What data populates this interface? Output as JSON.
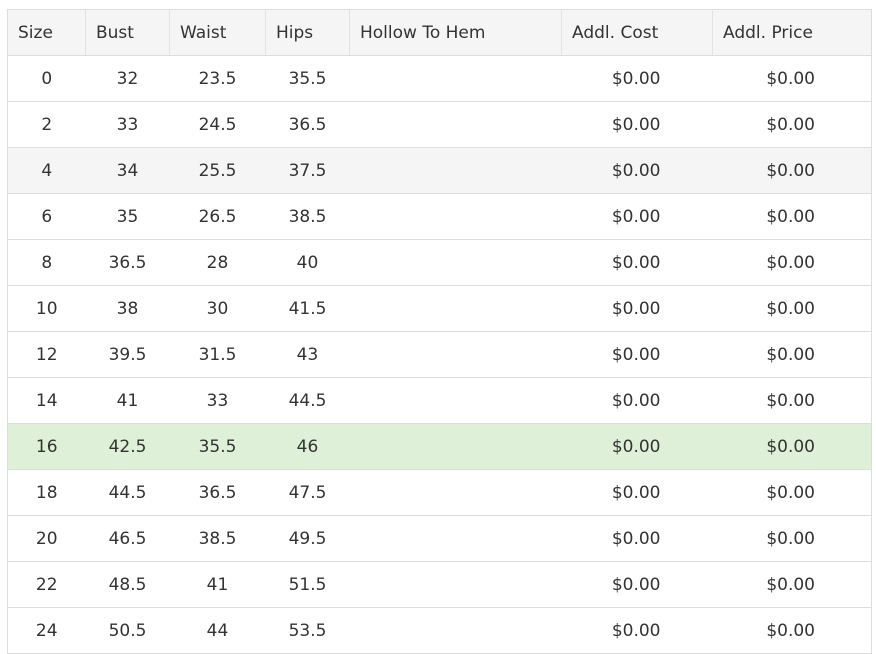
{
  "table": {
    "columns": [
      "Size",
      "Bust",
      "Waist",
      "Hips",
      "Hollow To Hem",
      "Addl. Cost",
      "Addl. Price"
    ],
    "rows": [
      {
        "size": "0",
        "bust": "32",
        "waist": "23.5",
        "hips": "35.5",
        "hollow": "",
        "cost": "$0.00",
        "price": "$0.00"
      },
      {
        "size": "2",
        "bust": "33",
        "waist": "24.5",
        "hips": "36.5",
        "hollow": "",
        "cost": "$0.00",
        "price": "$0.00"
      },
      {
        "size": "4",
        "bust": "34",
        "waist": "25.5",
        "hips": "37.5",
        "hollow": "",
        "cost": "$0.00",
        "price": "$0.00"
      },
      {
        "size": "6",
        "bust": "35",
        "waist": "26.5",
        "hips": "38.5",
        "hollow": "",
        "cost": "$0.00",
        "price": "$0.00"
      },
      {
        "size": "8",
        "bust": "36.5",
        "waist": "28",
        "hips": "40",
        "hollow": "",
        "cost": "$0.00",
        "price": "$0.00"
      },
      {
        "size": "10",
        "bust": "38",
        "waist": "30",
        "hips": "41.5",
        "hollow": "",
        "cost": "$0.00",
        "price": "$0.00"
      },
      {
        "size": "12",
        "bust": "39.5",
        "waist": "31.5",
        "hips": "43",
        "hollow": "",
        "cost": "$0.00",
        "price": "$0.00"
      },
      {
        "size": "14",
        "bust": "41",
        "waist": "33",
        "hips": "44.5",
        "hollow": "",
        "cost": "$0.00",
        "price": "$0.00"
      },
      {
        "size": "16",
        "bust": "42.5",
        "waist": "35.5",
        "hips": "46",
        "hollow": "",
        "cost": "$0.00",
        "price": "$0.00"
      },
      {
        "size": "18",
        "bust": "44.5",
        "waist": "36.5",
        "hips": "47.5",
        "hollow": "",
        "cost": "$0.00",
        "price": "$0.00"
      },
      {
        "size": "20",
        "bust": "46.5",
        "waist": "38.5",
        "hips": "49.5",
        "hollow": "",
        "cost": "$0.00",
        "price": "$0.00"
      },
      {
        "size": "22",
        "bust": "48.5",
        "waist": "41",
        "hips": "51.5",
        "hollow": "",
        "cost": "$0.00",
        "price": "$0.00"
      },
      {
        "size": "24",
        "bust": "50.5",
        "waist": "44",
        "hips": "53.5",
        "hollow": "",
        "cost": "$0.00",
        "price": "$0.00"
      }
    ],
    "hover_row_index": 2,
    "selected_row_index": 8,
    "colors": {
      "header_bg": "#f5f5f5",
      "hover_bg": "#f5f5f5",
      "selected_bg": "#dff0d8",
      "border": "#dddddd",
      "text": "#333333"
    }
  }
}
